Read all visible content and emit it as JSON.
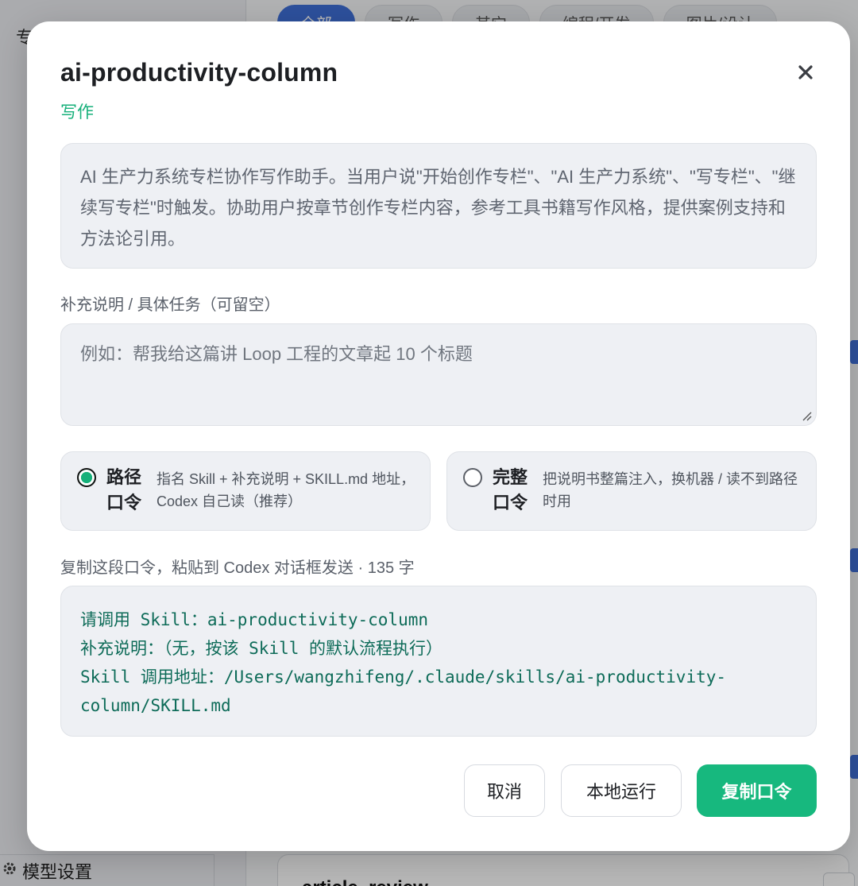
{
  "background": {
    "sidebar_top_text": "专",
    "sidebar_bottom_label": "模型设置",
    "filter_chips": [
      "全部",
      "写作",
      "其它",
      "编程/开发",
      "图片/设计"
    ],
    "card_title": "article_review"
  },
  "modal": {
    "title": "ai-productivity-column",
    "category": "写作",
    "description": "AI 生产力系统专栏协作写作助手。当用户说\"开始创作专栏\"、\"AI 生产力系统\"、\"写专栏\"、\"继续写专栏\"时触发。协助用户按章节创作专栏内容，参考工具书籍写作风格，提供案例支持和方法论引用。",
    "supplement_label": "补充说明 / 具体任务（可留空）",
    "supplement_placeholder": "例如：帮我给这篇讲 Loop 工程的文章起 10 个标题",
    "modes": [
      {
        "name": "路径口令",
        "description": "指名 Skill + 补充说明 + SKILL.md 地址，Codex 自己读（推荐）",
        "selected": true
      },
      {
        "name": "完整口令",
        "description": "把说明书整篇注入，换机器 / 读不到路径时用",
        "selected": false
      }
    ],
    "copy_label": "复制这段口令，粘贴到 Codex 对话框发送 · 135 字",
    "command_text": "请调用 Skill：ai-productivity-column\n补充说明：（无，按该 Skill 的默认流程执行）\nSkill 调用地址：/Users/wangzhifeng/.claude/skills/ai-productivity-column/SKILL.md",
    "buttons": {
      "cancel": "取消",
      "run_local": "本地运行",
      "copy_command": "复制口令"
    }
  },
  "colors": {
    "accent_green": "#17b87e",
    "category_green": "#16b07a",
    "command_text": "#0d6b58"
  }
}
